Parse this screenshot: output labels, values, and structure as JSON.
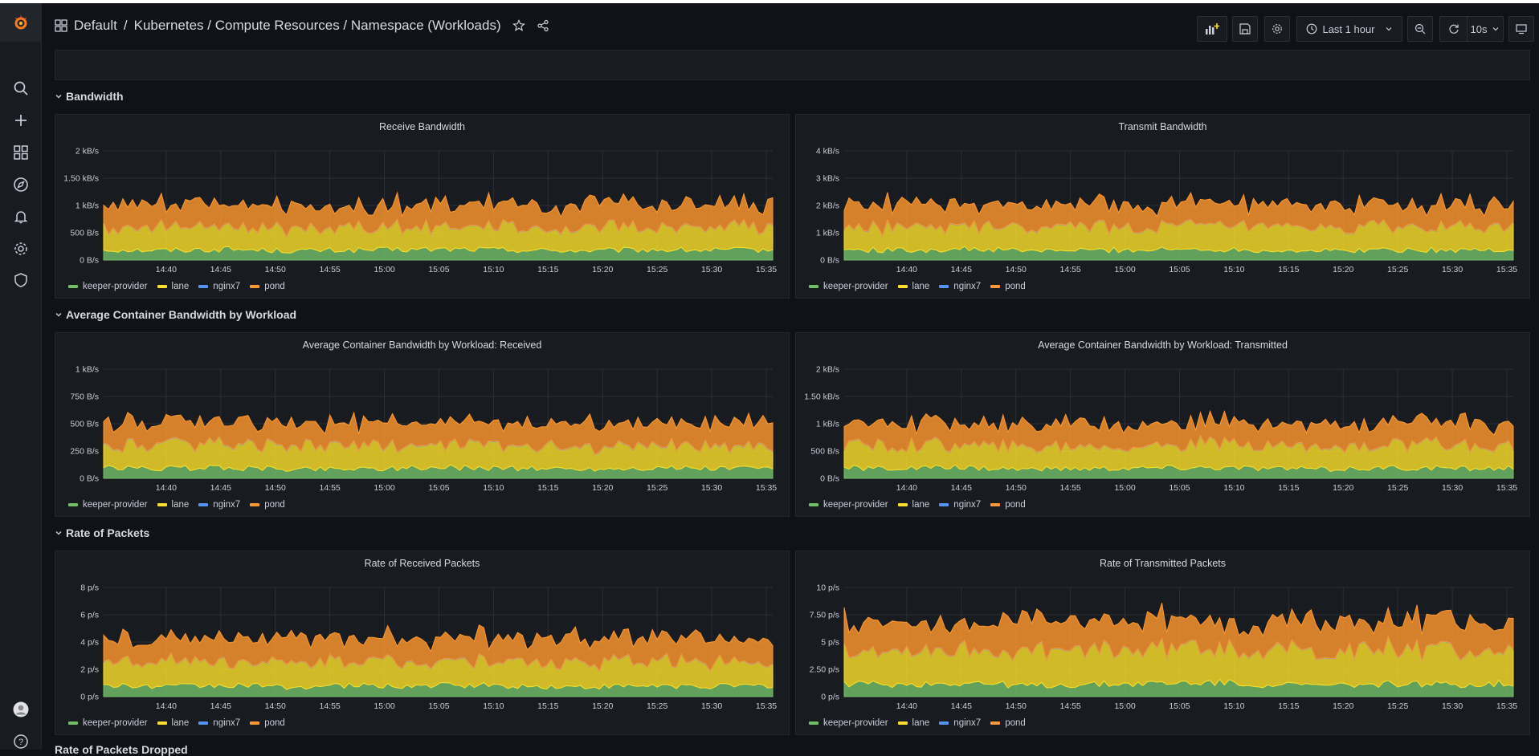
{
  "breadcrumb": {
    "folder": "Default",
    "separator": "/",
    "path": "Kubernetes / Compute Resources / Namespace (Workloads)"
  },
  "toolbar": {
    "time_range": "Last 1 hour",
    "refresh_interval": "10s"
  },
  "sections": [
    {
      "title": "Bandwidth"
    },
    {
      "title": "Average Container Bandwidth by Workload"
    },
    {
      "title": "Rate of Packets"
    }
  ],
  "next_section_title": "Rate of Packets Dropped",
  "legend": [
    "keeper-provider",
    "lane",
    "nginx7",
    "pond"
  ],
  "colors": {
    "keeper-provider": "#73bf69",
    "lane": "#fade2a",
    "nginx7": "#5794f2",
    "pond": "#ff9830"
  },
  "chart_data": [
    {
      "type": "area",
      "title": "Receive Bandwidth",
      "x": [
        "14:40",
        "14:45",
        "14:50",
        "14:55",
        "15:00",
        "15:05",
        "15:10",
        "15:15",
        "15:20",
        "15:25",
        "15:30",
        "15:35"
      ],
      "yticks": [
        "0 B/s",
        "500 B/s",
        "1 kB/s",
        "1.50 kB/s",
        "2 kB/s"
      ],
      "ylim": [
        0,
        2000
      ],
      "stacked": true,
      "series": [
        {
          "name": "keeper-provider",
          "values": [
            190,
            180,
            200,
            170,
            180,
            190,
            200,
            180,
            170,
            190,
            180,
            190
          ]
        },
        {
          "name": "lane",
          "values": [
            400,
            420,
            410,
            390,
            430,
            400,
            440,
            410,
            400,
            420,
            410,
            400
          ]
        },
        {
          "name": "nginx7",
          "values": [
            5,
            5,
            5,
            5,
            5,
            5,
            5,
            5,
            5,
            5,
            5,
            5
          ]
        },
        {
          "name": "pond",
          "values": [
            410,
            420,
            400,
            430,
            410,
            420,
            400,
            410,
            430,
            400,
            420,
            410
          ]
        }
      ]
    },
    {
      "type": "area",
      "title": "Transmit Bandwidth",
      "x": [
        "14:40",
        "14:45",
        "14:50",
        "14:55",
        "15:00",
        "15:05",
        "15:10",
        "15:15",
        "15:20",
        "15:25",
        "15:30",
        "15:35"
      ],
      "yticks": [
        "0 B/s",
        "1 kB/s",
        "2 kB/s",
        "3 kB/s",
        "4 kB/s"
      ],
      "ylim": [
        0,
        4000
      ],
      "stacked": true,
      "series": [
        {
          "name": "keeper-provider",
          "values": [
            380,
            360,
            400,
            340,
            360,
            380,
            400,
            360,
            340,
            380,
            360,
            380
          ]
        },
        {
          "name": "lane",
          "values": [
            800,
            840,
            820,
            780,
            860,
            800,
            880,
            820,
            800,
            840,
            820,
            800
          ]
        },
        {
          "name": "nginx7",
          "values": [
            10,
            10,
            10,
            10,
            10,
            10,
            10,
            10,
            10,
            10,
            10,
            10
          ]
        },
        {
          "name": "pond",
          "values": [
            820,
            840,
            800,
            860,
            820,
            840,
            800,
            820,
            860,
            800,
            840,
            820
          ]
        }
      ]
    },
    {
      "type": "area",
      "title": "Average Container Bandwidth by Workload: Received",
      "x": [
        "14:40",
        "14:45",
        "14:50",
        "14:55",
        "15:00",
        "15:05",
        "15:10",
        "15:15",
        "15:20",
        "15:25",
        "15:30",
        "15:35"
      ],
      "yticks": [
        "0 B/s",
        "250 B/s",
        "500 B/s",
        "750 B/s",
        "1 kB/s"
      ],
      "ylim": [
        0,
        1000
      ],
      "stacked": true,
      "series": [
        {
          "name": "keeper-provider",
          "values": [
            95,
            90,
            100,
            85,
            90,
            95,
            100,
            90,
            85,
            95,
            90,
            95
          ]
        },
        {
          "name": "lane",
          "values": [
            200,
            210,
            205,
            195,
            215,
            200,
            220,
            205,
            200,
            210,
            205,
            200
          ]
        },
        {
          "name": "nginx7",
          "values": [
            3,
            3,
            3,
            3,
            3,
            3,
            3,
            3,
            3,
            3,
            3,
            3
          ]
        },
        {
          "name": "pond",
          "values": [
            205,
            210,
            200,
            215,
            205,
            210,
            200,
            205,
            215,
            200,
            210,
            205
          ]
        }
      ]
    },
    {
      "type": "area",
      "title": "Average Container Bandwidth by Workload: Transmitted",
      "x": [
        "14:40",
        "14:45",
        "14:50",
        "14:55",
        "15:00",
        "15:05",
        "15:10",
        "15:15",
        "15:20",
        "15:25",
        "15:30",
        "15:35"
      ],
      "yticks": [
        "0 B/s",
        "500 B/s",
        "1 kB/s",
        "1.50 kB/s",
        "2 kB/s"
      ],
      "ylim": [
        0,
        2000
      ],
      "stacked": true,
      "series": [
        {
          "name": "keeper-provider",
          "values": [
            190,
            180,
            200,
            170,
            180,
            190,
            200,
            180,
            170,
            190,
            180,
            190
          ]
        },
        {
          "name": "lane",
          "values": [
            400,
            420,
            410,
            390,
            430,
            400,
            440,
            410,
            400,
            420,
            410,
            400
          ]
        },
        {
          "name": "nginx7",
          "values": [
            5,
            5,
            5,
            5,
            5,
            5,
            5,
            5,
            5,
            5,
            5,
            5
          ]
        },
        {
          "name": "pond",
          "values": [
            410,
            420,
            400,
            430,
            410,
            420,
            400,
            410,
            430,
            400,
            420,
            410
          ]
        }
      ]
    },
    {
      "type": "area",
      "title": "Rate of Received Packets",
      "x": [
        "14:40",
        "14:45",
        "14:50",
        "14:55",
        "15:00",
        "15:05",
        "15:10",
        "15:15",
        "15:20",
        "15:25",
        "15:30",
        "15:35"
      ],
      "yticks": [
        "0 p/s",
        "2 p/s",
        "4 p/s",
        "6 p/s",
        "8 p/s"
      ],
      "ylim": [
        0,
        8
      ],
      "stacked": true,
      "series": [
        {
          "name": "keeper-provider",
          "values": [
            0.8,
            0.75,
            0.85,
            0.7,
            0.8,
            0.8,
            0.85,
            0.75,
            0.7,
            0.8,
            0.75,
            0.8
          ]
        },
        {
          "name": "lane",
          "values": [
            1.7,
            1.8,
            1.75,
            1.65,
            1.85,
            1.7,
            1.9,
            1.75,
            1.7,
            1.8,
            1.75,
            1.7
          ]
        },
        {
          "name": "nginx7",
          "values": [
            0.02,
            0.02,
            0.02,
            0.02,
            0.02,
            0.02,
            0.02,
            0.02,
            0.02,
            0.02,
            0.02,
            0.02
          ]
        },
        {
          "name": "pond",
          "values": [
            1.7,
            1.75,
            1.65,
            1.8,
            1.7,
            1.75,
            1.65,
            1.7,
            1.8,
            1.65,
            1.75,
            1.7
          ]
        }
      ]
    },
    {
      "type": "area",
      "title": "Rate of Transmitted Packets",
      "x": [
        "14:40",
        "14:45",
        "14:50",
        "14:55",
        "15:00",
        "15:05",
        "15:10",
        "15:15",
        "15:20",
        "15:25",
        "15:30",
        "15:35"
      ],
      "yticks": [
        "0 p/s",
        "2.50 p/s",
        "5 p/s",
        "7.50 p/s",
        "10 p/s"
      ],
      "ylim": [
        0,
        10
      ],
      "stacked": true,
      "series": [
        {
          "name": "keeper-provider",
          "values": [
            1.2,
            1.1,
            1.3,
            1.0,
            1.1,
            1.2,
            1.3,
            1.1,
            1.0,
            1.2,
            1.1,
            1.2
          ]
        },
        {
          "name": "lane",
          "values": [
            3.0,
            3.2,
            3.1,
            2.9,
            3.3,
            3.0,
            3.4,
            3.1,
            3.0,
            3.2,
            3.1,
            3.0
          ]
        },
        {
          "name": "nginx7",
          "values": [
            0.03,
            0.03,
            0.03,
            0.03,
            0.03,
            0.03,
            0.03,
            0.03,
            0.03,
            0.03,
            0.03,
            0.03
          ]
        },
        {
          "name": "pond",
          "values": [
            2.6,
            2.7,
            2.5,
            2.8,
            2.6,
            2.7,
            2.5,
            2.6,
            2.8,
            2.5,
            2.7,
            2.6
          ]
        }
      ]
    }
  ]
}
